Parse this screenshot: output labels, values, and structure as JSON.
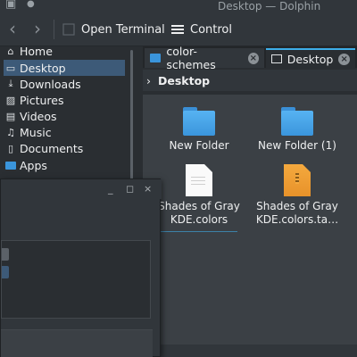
{
  "window": {
    "title": "Desktop — Dolphin"
  },
  "toolbar": {
    "back_icon": "chevron-left-icon",
    "forward_icon": "chevron-right-icon",
    "open_terminal_label": "Open Terminal",
    "control_label": "Control"
  },
  "sidebar": {
    "items": [
      {
        "label": "Home",
        "icon": "home-icon"
      },
      {
        "label": "Desktop",
        "icon": "desktop-icon",
        "active": true
      },
      {
        "label": "Downloads",
        "icon": "download-icon"
      },
      {
        "label": "Pictures",
        "icon": "image-icon"
      },
      {
        "label": "Videos",
        "icon": "video-icon"
      },
      {
        "label": "Music",
        "icon": "music-icon"
      },
      {
        "label": "Documents",
        "icon": "document-icon"
      },
      {
        "label": "Apps",
        "icon": "folder-icon"
      }
    ]
  },
  "tabs": [
    {
      "label": "color-schemes",
      "active": false
    },
    {
      "label": "Desktop",
      "active": true
    }
  ],
  "breadcrumb": {
    "current": "Desktop"
  },
  "files": [
    {
      "name": "New Folder",
      "type": "folder"
    },
    {
      "name": "New Folder (1)",
      "type": "folder"
    },
    {
      "name_line1": "Shades of Gray",
      "name_line2": "KDE.colors",
      "type": "document"
    },
    {
      "name_line1": "Shades of Gray",
      "name_line2": "KDE.colors.ta…",
      "type": "archive"
    }
  ],
  "colors": {
    "accent": "#3daee9",
    "selection": "#3d5a78",
    "window_bg": "#31363b",
    "view_bg": "#3b4045"
  }
}
